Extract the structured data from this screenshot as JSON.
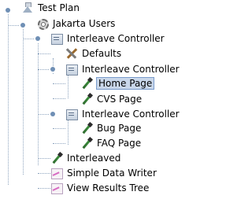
{
  "tree": {
    "nodes": [
      {
        "label": "Test Plan",
        "icon": "flask-icon"
      },
      {
        "label": "Jakarta Users",
        "icon": "gear-icon"
      },
      {
        "label": "Interleave Controller",
        "icon": "controller-icon"
      },
      {
        "label": "Defaults",
        "icon": "tools-icon"
      },
      {
        "label": "Interleave Controller",
        "icon": "controller-icon"
      },
      {
        "label": "Home Page",
        "icon": "pipette-icon",
        "selected": true
      },
      {
        "label": "CVS Page",
        "icon": "pipette-icon"
      },
      {
        "label": "Interleave Controller",
        "icon": "controller-icon"
      },
      {
        "label": "Bug Page",
        "icon": "pipette-icon"
      },
      {
        "label": "FAQ Page",
        "icon": "pipette-icon"
      },
      {
        "label": "Interleaved",
        "icon": "pipette-icon"
      },
      {
        "label": "Simple Data Writer",
        "icon": "graph-icon"
      },
      {
        "label": "View Results Tree",
        "icon": "graph-icon"
      }
    ]
  },
  "colors": {
    "selection_bg": "#c9d7ea",
    "selection_border": "#7a9ccc",
    "tree_lines": "#8fa5bf"
  }
}
